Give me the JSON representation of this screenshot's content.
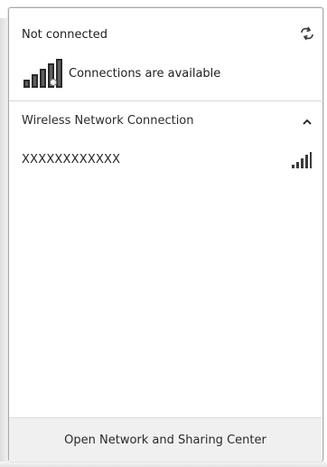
{
  "status": {
    "title": "Not connected",
    "subtitle": "Connections are available"
  },
  "icons": {
    "refresh": "refresh-icon",
    "network_bars": "network-bars-icon",
    "chevron": "chevron-up-icon",
    "signal": "signal-strength-icon"
  },
  "section": {
    "label": "Wireless Network Connection"
  },
  "networks": [
    {
      "name": "XXXXXXXXXXXX",
      "signal_bars": 5
    }
  ],
  "footer": {
    "link": "Open Network and Sharing Center"
  },
  "colors": {
    "accent": "#3c3c3c",
    "footer_bg": "#f0f0f0",
    "border": "#a9a9a9"
  }
}
